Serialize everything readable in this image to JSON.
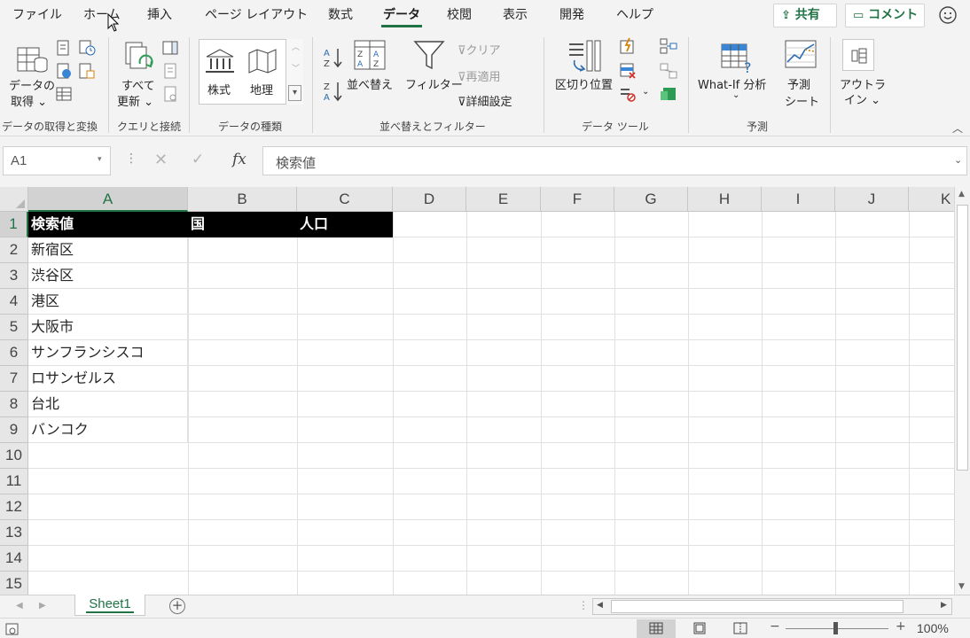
{
  "ribbon_tabs": [
    "ファイル",
    "ホーム",
    "挿入",
    "ページ レイアウト",
    "数式",
    "データ",
    "校閲",
    "表示",
    "開発",
    "ヘルプ"
  ],
  "active_tab": "データ",
  "share_label": "共有",
  "comment_label": "コメント",
  "groups": {
    "get_transform": {
      "label": "データの取得と変換",
      "get_data_line1": "データの",
      "get_data_line2": "取得"
    },
    "queries": {
      "label": "クエリと接続",
      "refresh_line1": "すべて",
      "refresh_line2": "更新"
    },
    "data_types": {
      "label": "データの種類",
      "stocks": "株式",
      "geography": "地理"
    },
    "sort_filter": {
      "label": "並べ替えとフィルター",
      "sort": "並べ替え",
      "filter": "フィルター",
      "clear": "クリア",
      "reapply": "再適用",
      "advanced": "詳細設定"
    },
    "data_tools": {
      "label": "データ ツール",
      "text_to_columns": "区切り位置"
    },
    "forecast": {
      "label": "予測",
      "what_if": "What-If 分析",
      "forecast_line1": "予測",
      "forecast_line2": "シート"
    },
    "outline": {
      "line1": "アウトラ",
      "line2": "イン"
    }
  },
  "name_box": "A1",
  "formula_value": "検索値",
  "columns": [
    "A",
    "B",
    "C",
    "D",
    "E",
    "F",
    "G",
    "H",
    "I",
    "J",
    "K"
  ],
  "rows": [
    "1",
    "2",
    "3",
    "4",
    "5",
    "6",
    "7",
    "8",
    "9",
    "10",
    "11",
    "12",
    "13",
    "14",
    "15"
  ],
  "cells": {
    "A1": "検索値",
    "B1": "国",
    "C1": "人口",
    "A2": "新宿区",
    "A3": "渋谷区",
    "A4": "港区",
    "A5": "大阪市",
    "A6": "サンフランシスコ",
    "A7": "ロサンゼルス",
    "A8": "台北",
    "A9": "バンコク"
  },
  "sheet_tab": "Sheet1",
  "zoom": "100%",
  "colors": {
    "accent": "#217346",
    "header_fill": "#000000",
    "header_text": "#ffffff"
  }
}
